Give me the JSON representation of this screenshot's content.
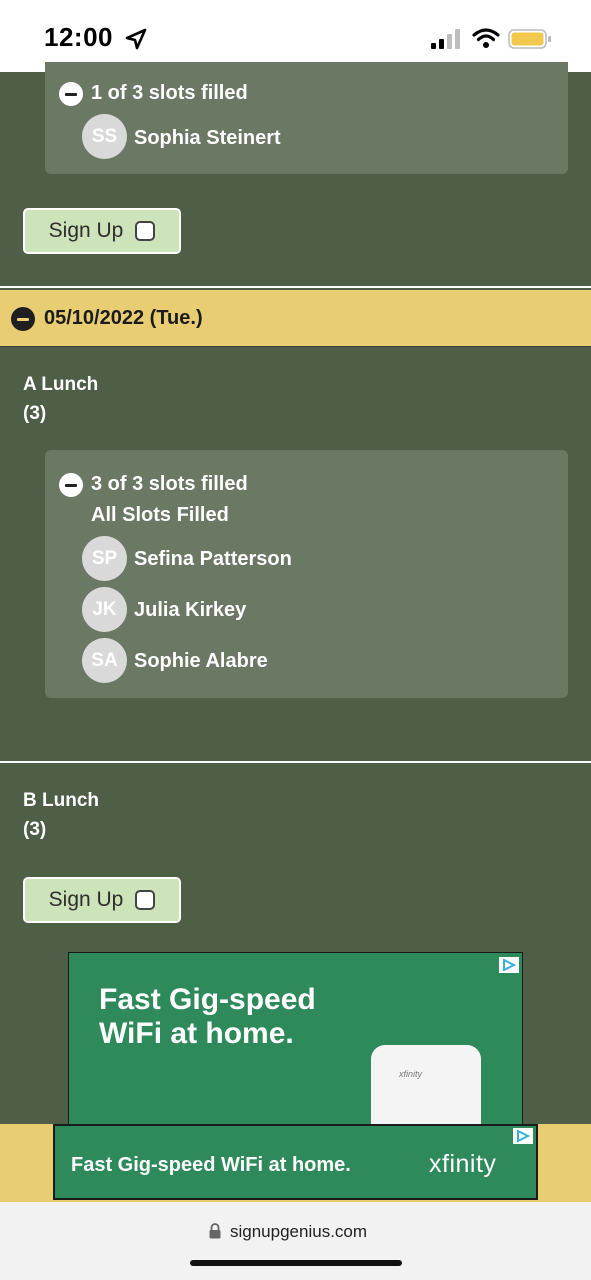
{
  "status_bar": {
    "time": "12:00"
  },
  "first_slot": {
    "summary": "1 of 3 slots filled",
    "people": [
      {
        "initials": "SS",
        "name": "Sophia Steinert"
      }
    ],
    "signup_label": "Sign Up"
  },
  "date_header": {
    "label": "05/10/2022 (Tue.)"
  },
  "a_lunch": {
    "title": "A Lunch",
    "count": "(3)",
    "summary": "3 of 3 slots filled",
    "status": "All Slots Filled",
    "people": [
      {
        "initials": "SP",
        "name": "Sefina Patterson"
      },
      {
        "initials": "JK",
        "name": "Julia Kirkey"
      },
      {
        "initials": "SA",
        "name": "Sophie Alabre"
      }
    ]
  },
  "b_lunch": {
    "title": "B Lunch",
    "count": "(3)",
    "signup_label": "Sign Up"
  },
  "ad_top": {
    "headline": "Fast Gig-speed WiFi at home.",
    "device_brand": "xfinity"
  },
  "ad_bottom": {
    "text": "Fast Gig-speed WiFi at home.",
    "brand": "xfinity"
  },
  "browser": {
    "url": "signupgenius.com"
  },
  "colors": {
    "page_bg": "#4f5e47",
    "panel": "#6a7864",
    "date_band": "#e8cd72",
    "button": "#cde3b9",
    "ad_green": "#2f8a5b"
  }
}
